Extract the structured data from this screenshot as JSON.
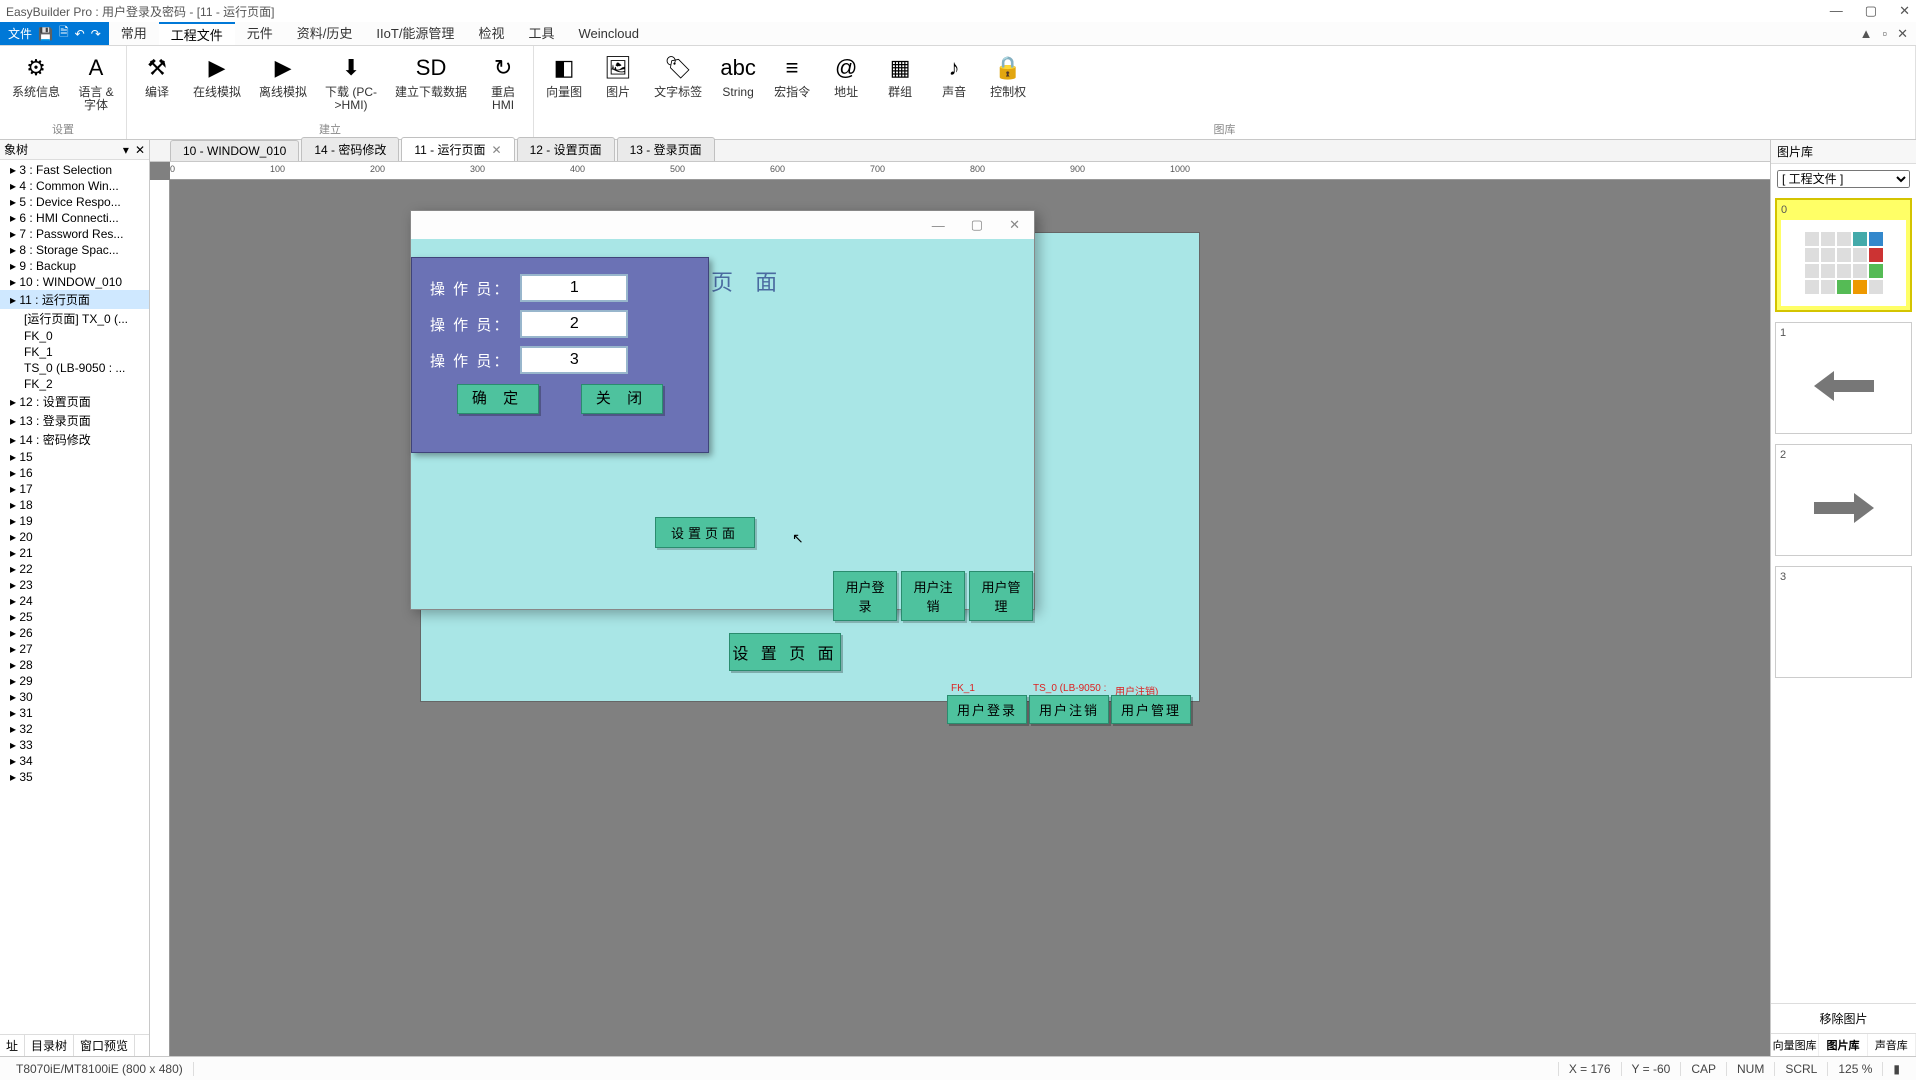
{
  "title": "EasyBuilder Pro : 用户登录及密码 - [11 - 运行页面]",
  "win_buttons": [
    "—",
    "▢",
    "✕"
  ],
  "menutabs": {
    "file": "文件",
    "items": [
      "常用",
      "工程文件",
      "元件",
      "资料/历史",
      "IIoT/能源管理",
      "检视",
      "工具",
      "Weincloud"
    ],
    "active_index": 1
  },
  "ribbon_right": [
    "▲",
    "▫",
    "✕"
  ],
  "ribbon": {
    "g1": {
      "name": "设置",
      "btns": [
        {
          "ico": "⚙",
          "lab": "系统信息"
        },
        {
          "ico": "A",
          "lab": "语言 &\n字体"
        }
      ]
    },
    "g2": {
      "name": "建立",
      "btns": [
        {
          "ico": "⚒",
          "lab": "编译"
        },
        {
          "ico": "▶",
          "lab": "在线模拟"
        },
        {
          "ico": "▶",
          "lab": "离线模拟"
        },
        {
          "ico": "⬇",
          "lab": "下载 (PC-\n>HMI)"
        },
        {
          "ico": "SD",
          "lab": "建立下载数据"
        },
        {
          "ico": "↻",
          "lab": "重启\nHMI"
        }
      ]
    },
    "g3": {
      "name": "图库",
      "btns": [
        {
          "ico": "◧",
          "lab": "向量图"
        },
        {
          "ico": "🖼",
          "lab": "图片"
        },
        {
          "ico": "🏷",
          "lab": "文字标签"
        },
        {
          "ico": "abc",
          "lab": "String"
        },
        {
          "ico": "≡",
          "lab": "宏指令"
        },
        {
          "ico": "@",
          "lab": "地址"
        },
        {
          "ico": "▦",
          "lab": "群组"
        },
        {
          "ico": "♪",
          "lab": "声音"
        },
        {
          "ico": "🔒",
          "lab": "控制权"
        }
      ]
    }
  },
  "left": {
    "header": "象树",
    "tabs": [
      "址",
      "目录树",
      "窗口预览"
    ],
    "tabs_active": 1,
    "nodes": [
      {
        "t": "3 : Fast Selection"
      },
      {
        "t": "4 : Common Win..."
      },
      {
        "t": "5 : Device Respo..."
      },
      {
        "t": "6 : HMI Connecti..."
      },
      {
        "t": "7 : Password Res..."
      },
      {
        "t": "8 : Storage Spac..."
      },
      {
        "t": "9 : Backup"
      },
      {
        "t": "10 : WINDOW_010"
      },
      {
        "t": "11 : 运行页面",
        "sel": true
      },
      {
        "t": "[运行页面] TX_0 (...",
        "sub": true
      },
      {
        "t": "FK_0",
        "sub": true
      },
      {
        "t": "FK_1",
        "sub": true
      },
      {
        "t": "TS_0 (LB-9050 : ...",
        "sub": true
      },
      {
        "t": "FK_2",
        "sub": true
      },
      {
        "t": "12 : 设置页面"
      },
      {
        "t": "13 : 登录页面"
      },
      {
        "t": "14 : 密码修改"
      },
      {
        "t": "15"
      },
      {
        "t": "16"
      },
      {
        "t": "17"
      },
      {
        "t": "18"
      },
      {
        "t": "19"
      },
      {
        "t": "20"
      },
      {
        "t": "21"
      },
      {
        "t": "22"
      },
      {
        "t": "23"
      },
      {
        "t": "24"
      },
      {
        "t": "25"
      },
      {
        "t": "26"
      },
      {
        "t": "27"
      },
      {
        "t": "28"
      },
      {
        "t": "29"
      },
      {
        "t": "30"
      },
      {
        "t": "31"
      },
      {
        "t": "32"
      },
      {
        "t": "33"
      },
      {
        "t": "34"
      },
      {
        "t": "35"
      }
    ]
  },
  "doctabs": [
    {
      "t": "10 - WINDOW_010"
    },
    {
      "t": "14 - 密码修改"
    },
    {
      "t": "11 - 运行页面",
      "act": true,
      "close": "✕"
    },
    {
      "t": "12 - 设置页面"
    },
    {
      "t": "13 - 登录页面"
    }
  ],
  "ruler_ticks": [
    "0",
    "100",
    "200",
    "300",
    "400",
    "500",
    "600",
    "700",
    "800",
    "900",
    "1000"
  ],
  "canvas": {
    "page_title_fragment": "页 面",
    "btn_settings": "设 置 页 面",
    "btn_login": "用户登录",
    "btn_logout": "用户注销",
    "btn_manage": "用户管理",
    "tag_fk1": "FK_1",
    "tag_ts0": "TS_0 (LB-9050 :",
    "tag_logout": "用户注销)"
  },
  "floatwin": {
    "winbtns": [
      "—",
      "▢",
      "✕"
    ],
    "row_label": "操 作 员：",
    "vals": [
      "1",
      "2",
      "3"
    ],
    "ok": "确 定",
    "close": "关 闭",
    "inner_settings": "设置页面",
    "inner_login": "用户登录",
    "inner_logout": "用户注销",
    "inner_manage": "用户管理"
  },
  "right": {
    "header": "图片库",
    "dropdown": "[ 工程文件 ]",
    "thumbs": [
      {
        "n": "0"
      },
      {
        "n": "1"
      },
      {
        "n": "2"
      },
      {
        "n": "3"
      }
    ],
    "remove": "移除图片",
    "tabs": [
      "向量图库",
      "图片库",
      "声音库"
    ],
    "tabs_active": 1
  },
  "status": {
    "model": "T8070iE/MT8100iE (800 x 480)",
    "x": "X = 176",
    "y": "Y = -60",
    "cap": "CAP",
    "num": "NUM",
    "scrl": "SCRL",
    "zoom": "125 %"
  }
}
